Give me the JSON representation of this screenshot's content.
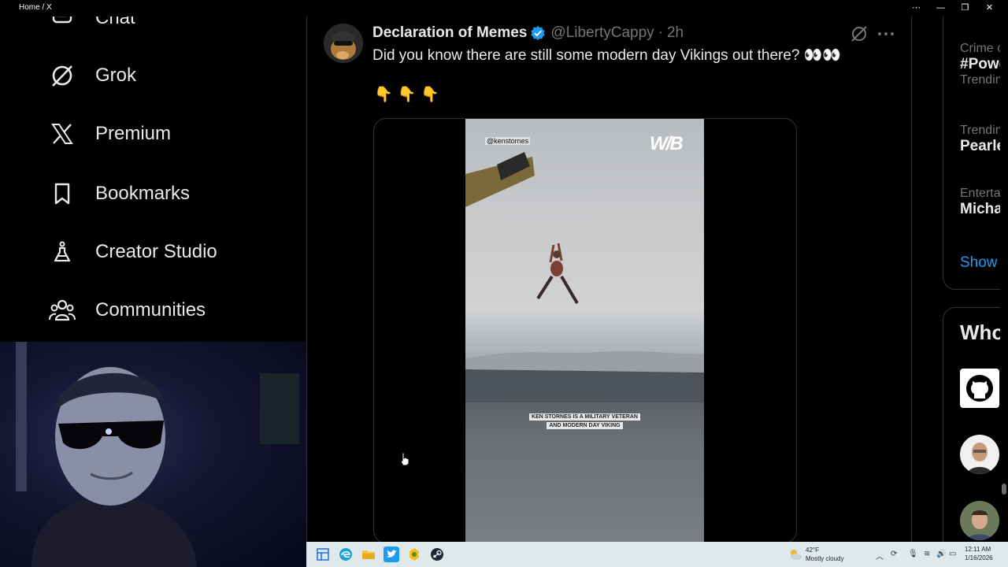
{
  "window": {
    "title": "Home / X",
    "buttons": [
      "⋯",
      "—",
      "❐",
      "✕"
    ]
  },
  "sidebar": {
    "items": [
      {
        "label": "Chat",
        "icon": "chat-icon"
      },
      {
        "label": "Grok",
        "icon": "grok-icon"
      },
      {
        "label": "Premium",
        "icon": "x-logo-icon"
      },
      {
        "label": "Bookmarks",
        "icon": "bookmark-icon"
      },
      {
        "label": "Creator Studio",
        "icon": "flask-icon"
      },
      {
        "label": "Communities",
        "icon": "people-icon"
      }
    ]
  },
  "tweet": {
    "author": "Declaration of Memes",
    "handle": "@LibertyCappy",
    "separator": "·",
    "time": "2h",
    "text": "Did you know there are still some modern day Vikings out there? 👀👀",
    "emoji_line": [
      "👇",
      "👇",
      "👇"
    ],
    "media": {
      "watermark": "@kenstornes",
      "logo": "W/B",
      "caption_lines": [
        "KEN STORNES IS A MILITARY VETERAN",
        "AND MODERN DAY VIKING"
      ]
    }
  },
  "trends": {
    "items": [
      {
        "meta": "Crime ove",
        "title": "#Powe",
        "sub": "Trendin"
      },
      {
        "meta": "Trendin",
        "title": "Pearle"
      },
      {
        "meta": "Enterta",
        "title": "Micha"
      }
    ],
    "show_more": "Show"
  },
  "who_to_follow": {
    "title": "Who"
  },
  "taskbar": {
    "apps": [
      "start-icon",
      "edge-icon",
      "file-explorer-icon",
      "twitter-icon",
      "pinned-app-icon",
      "steam-icon"
    ],
    "weather_temp": "42°F",
    "weather_desc": "Mostly cloudy",
    "time": "12:11 AM",
    "date": "1/16/2026"
  },
  "colors": {
    "accent": "#1d9bf0",
    "border": "#2f3336",
    "muted_text": "#71767b",
    "taskbar": "#dfe9ec"
  }
}
